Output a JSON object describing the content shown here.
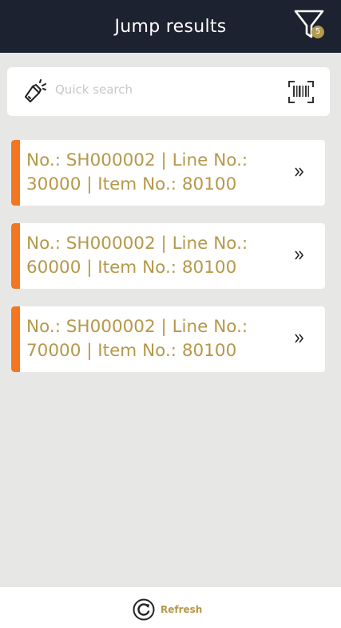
{
  "header": {
    "title": "Jump results",
    "filter_icon": "filter-icon",
    "filter_badge": "5"
  },
  "search": {
    "placeholder": "Quick search",
    "value": "",
    "left_icon": "flashlight-icon",
    "right_icon": "barcode-scan-icon"
  },
  "results": [
    {
      "text": "No.: SH000002 | Line No.: 30000 | Item No.: 80100"
    },
    {
      "text": "No.: SH000002 | Line No.: 60000 | Item No.: 80100"
    },
    {
      "text": "No.: SH000002 | Line No.: 70000 | Item No.: 80100"
    }
  ],
  "footer": {
    "refresh_label": "Refresh",
    "refresh_icon": "refresh-icon"
  },
  "colors": {
    "header_bg": "#1d2230",
    "accent": "#f47621",
    "text_gold": "#b5984a",
    "page_bg": "#e7e8e6"
  }
}
